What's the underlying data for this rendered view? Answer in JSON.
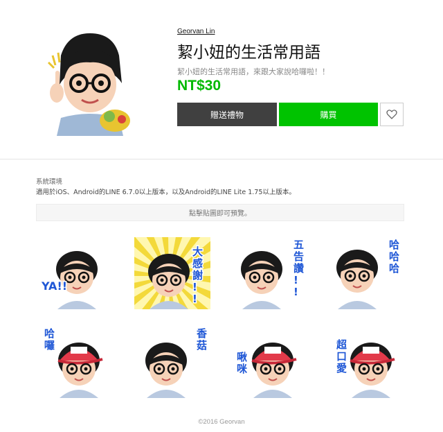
{
  "product": {
    "author": "Georvan Lin",
    "title": "絜小妞的生活常用語",
    "description": "絜小妞的生活常用語，來跟大家說哈囉啦！！",
    "price": "NT$30"
  },
  "actions": {
    "gift_label": "贈送禮物",
    "buy_label": "購買",
    "favorite_icon": "heart-icon"
  },
  "environment": {
    "label": "系統環境",
    "text": "適用於iOS、Android的LINE 6.7.0以上版本，以及Android的LINE Lite 1.75以上版本。"
  },
  "preview": {
    "hint": "點擊貼圖即可預覽。"
  },
  "stickers": [
    {
      "caption": "YA!!",
      "color": "#1f57d6"
    },
    {
      "caption": "大感謝!!",
      "color": "#1f57d6"
    },
    {
      "caption": "五告讚!!",
      "color": "#1f57d6"
    },
    {
      "caption": "哈哈哈",
      "color": "#1f57d6"
    },
    {
      "caption": "哈囉",
      "color": "#1f57d6"
    },
    {
      "caption": "香菇",
      "color": "#1f57d6"
    },
    {
      "caption": "啾咪",
      "color": "#1f57d6"
    },
    {
      "caption": "超口愛",
      "color": "#1f57d6"
    }
  ],
  "footer": {
    "copyright": "©2016 Georvan"
  },
  "colors": {
    "brand_green": "#00c300",
    "price_green": "#00b900",
    "gift_button": "#404040",
    "caption_blue": "#1f57d6"
  }
}
